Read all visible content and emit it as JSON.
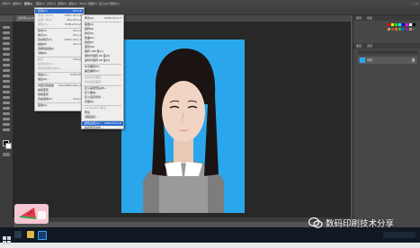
{
  "menubar": {
    "items": [
      "文件(F)",
      "编辑(E)",
      "图像(I)",
      "图层(L)",
      "文字(Y)",
      "选择(S)",
      "滤镜(T)",
      "3D(D)",
      "视图(V)",
      "窗口(W)",
      "帮助(H)"
    ]
  },
  "document": {
    "tab_label": "证件照.jpg @ 33.3%"
  },
  "edit_menu": {
    "items": [
      {
        "label": "还原(O)",
        "shortcut": "Ctrl+Z"
      },
      {
        "label": "前进一步(W)",
        "shortcut": "Shift+Ctrl+Z"
      },
      {
        "label": "后退一步(K)",
        "shortcut": "Alt+Ctrl+Z"
      },
      {
        "label": "渐隐(D)...",
        "shortcut": "Shift+Ctrl+F"
      },
      {
        "label": "剪切(T)",
        "shortcut": "Ctrl+X"
      },
      {
        "label": "拷贝(C)",
        "shortcut": "Ctrl+C"
      },
      {
        "label": "合并拷贝(Y)",
        "shortcut": "Shift+Ctrl+C"
      },
      {
        "label": "粘贴(P)",
        "shortcut": "Ctrl+V"
      },
      {
        "label": "选择性粘贴(I)",
        "shortcut": ""
      },
      {
        "label": "清除(E)",
        "shortcut": ""
      },
      {
        "label": "搜索",
        "shortcut": "Ctrl+F"
      },
      {
        "label": "拼写检查(H)...",
        "shortcut": ""
      },
      {
        "label": "查找和替换文本(X)...",
        "shortcut": ""
      },
      {
        "label": "填充(L)...",
        "shortcut": "Shift+F5"
      },
      {
        "label": "描边(S)...",
        "shortcut": ""
      },
      {
        "label": "内容识别缩放",
        "shortcut": "Alt+Shift+Ctrl+C"
      },
      {
        "label": "操控变形",
        "shortcut": ""
      },
      {
        "label": "透视变形",
        "shortcut": ""
      },
      {
        "label": "自由变换(F)",
        "shortcut": "Ctrl+T"
      },
      {
        "label": "变换(A)",
        "shortcut": ""
      }
    ]
  },
  "submenu": {
    "items": [
      {
        "label": "再次(A)",
        "shortcut": "Shift+Ctrl+T"
      },
      {
        "label": "缩放(S)",
        "shortcut": ""
      },
      {
        "label": "旋转(R)",
        "shortcut": ""
      },
      {
        "label": "斜切(K)",
        "shortcut": ""
      },
      {
        "label": "扭曲(D)",
        "shortcut": ""
      },
      {
        "label": "透视(P)",
        "shortcut": ""
      },
      {
        "label": "变形(W)",
        "shortcut": ""
      },
      {
        "label": "旋转 180 度(1)",
        "shortcut": ""
      },
      {
        "label": "顺时针旋转 90 度(9)",
        "shortcut": ""
      },
      {
        "label": "逆时针旋转 90 度(0)",
        "shortcut": ""
      },
      {
        "label": "水平翻转(H)",
        "shortcut": ""
      },
      {
        "label": "垂直翻转(V)",
        "shortcut": ""
      },
      {
        "label": "自动对齐图层...",
        "shortcut": ""
      },
      {
        "label": "自动混合图层...",
        "shortcut": ""
      },
      {
        "label": "定义画笔预设(B)...",
        "shortcut": ""
      },
      {
        "label": "定义图案...",
        "shortcut": ""
      },
      {
        "label": "定义自定形状...",
        "shortcut": ""
      },
      {
        "label": "清理(R)",
        "shortcut": ""
      },
      {
        "label": "Adobe PDF 预设...",
        "shortcut": ""
      },
      {
        "label": "预设",
        "shortcut": ""
      },
      {
        "label": "远程连接...",
        "shortcut": ""
      },
      {
        "label": "颜色设置(G)...",
        "shortcut": "Shift+Ctrl+K"
      },
      {
        "label": "指定配置文件...",
        "shortcut": ""
      },
      {
        "label": "转换为配置文件(V)...",
        "shortcut": ""
      }
    ]
  },
  "panel": {
    "tabs": [
      "颜色",
      "色板",
      "图层",
      "通道"
    ],
    "layers_title": "图层",
    "layer_name": "背景"
  },
  "watermark": {
    "text": "数码印刷技术分享"
  },
  "colors": {
    "photo_bg": "#2aa7ec",
    "highlight": "#2f6ccf"
  }
}
